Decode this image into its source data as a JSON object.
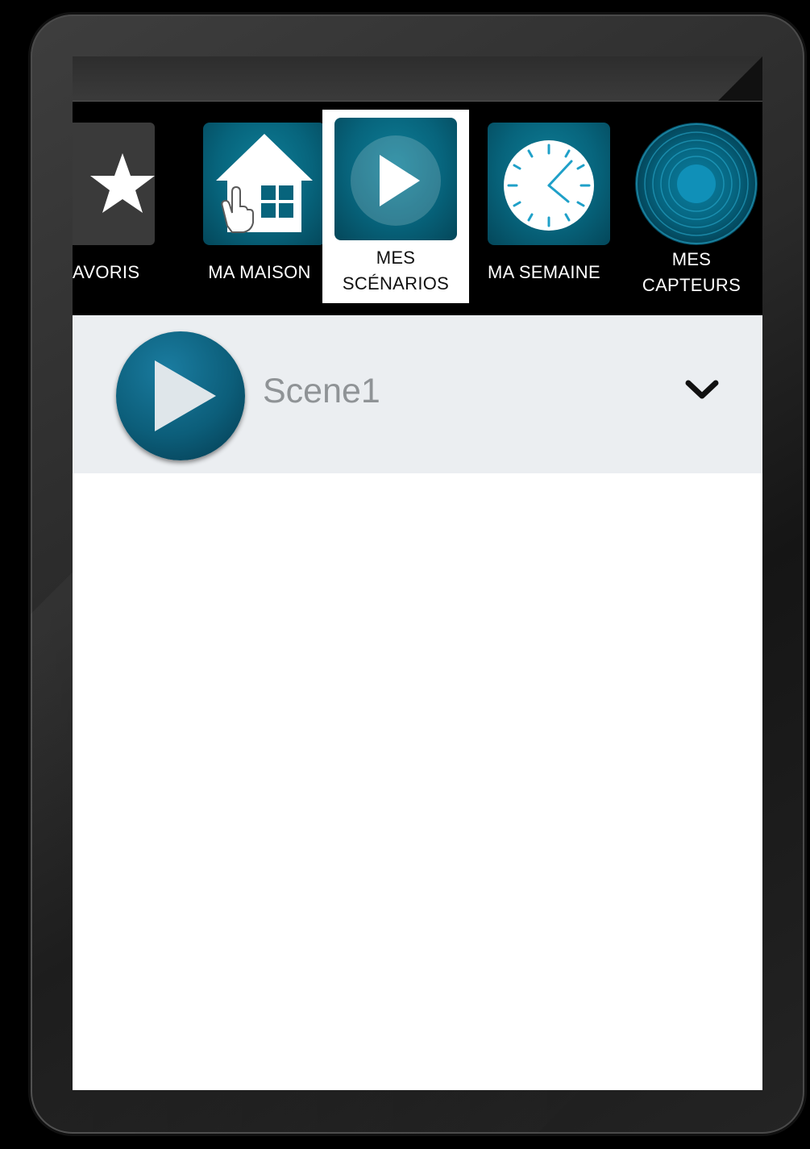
{
  "nav": {
    "tabs": [
      {
        "id": "favoris",
        "label": "AVORIS",
        "icon": "star-icon",
        "selected": false
      },
      {
        "id": "maison",
        "label": "MA MAISON",
        "icon": "house-icon",
        "selected": false
      },
      {
        "id": "scenarios",
        "label_line1": "MES",
        "label_line2": "SCÉNARIOS",
        "icon": "play-icon",
        "selected": true
      },
      {
        "id": "semaine",
        "label": "MA SEMAINE",
        "icon": "clock-icon",
        "selected": false
      },
      {
        "id": "capteurs",
        "label_line1": "MES",
        "label_line2": "CAPTEURS",
        "icon": "sensor-rings-icon",
        "selected": false
      }
    ]
  },
  "scenes": [
    {
      "name": "Scene1",
      "icon": "play-icon",
      "expand_icon": "chevron-down-icon"
    }
  ],
  "colors": {
    "accent": "#07647c",
    "nav_background": "#000000",
    "selected_tab_background": "#ffffff",
    "scene_row_background": "#ebeef1",
    "scene_text": "#8f9396"
  }
}
